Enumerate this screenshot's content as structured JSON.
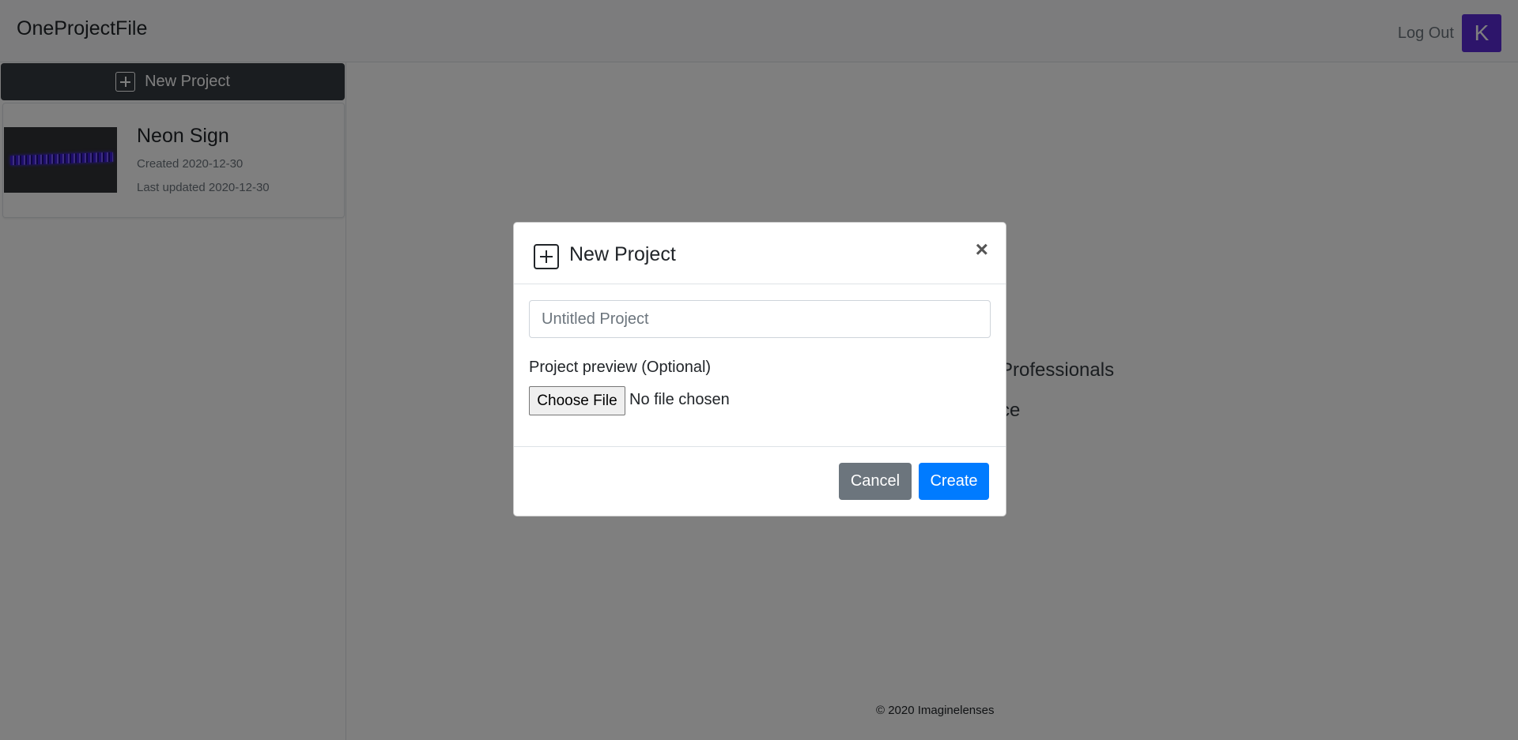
{
  "navbar": {
    "brand": "OneProjectFile",
    "logout_label": "Log Out",
    "avatar_initial": "K",
    "avatar_color": "#5b2bd6"
  },
  "sidebar": {
    "new_project_label": "New Project",
    "projects": [
      {
        "title": "Neon Sign",
        "created": "Created 2020-12-30",
        "updated": "Last updated 2020-12-30"
      }
    ]
  },
  "main": {
    "partial_line1": "Professionals",
    "partial_line2": "ce",
    "footer": "© 2020 Imaginelenses"
  },
  "modal": {
    "title": "New Project",
    "close_symbol": "×",
    "name_placeholder": "Untitled Project",
    "name_value": "",
    "preview_label": "Project preview (Optional)",
    "choose_file_label": "Choose File",
    "no_file_text": "No file chosen",
    "cancel_label": "Cancel",
    "create_label": "Create"
  },
  "colors": {
    "dark_button": "#343a40",
    "secondary": "#6c757d",
    "primary": "#007bff"
  }
}
